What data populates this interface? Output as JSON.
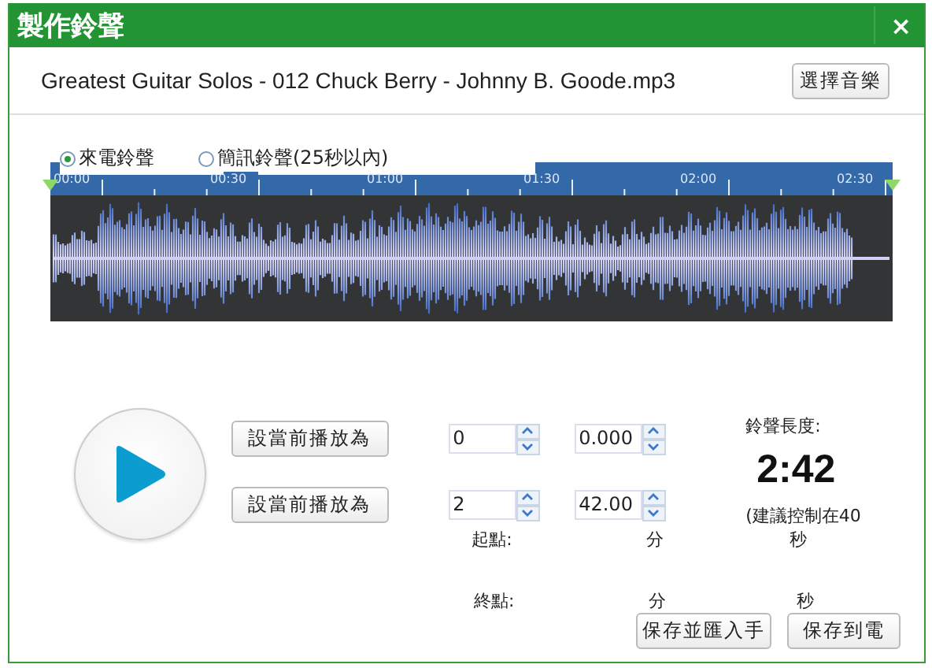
{
  "window": {
    "title": "製作鈴聲",
    "close": "×"
  },
  "file": {
    "name": "Greatest Guitar Solos - 012 Chuck Berry - Johnny B. Goode.mp3",
    "button": "選擇音樂"
  },
  "ringtone_types": [
    {
      "label": "來電鈴聲",
      "selected": true
    },
    {
      "label": "簡訊鈴聲(25秒以內)",
      "selected": false
    }
  ],
  "timeline": {
    "ticks": [
      "00:00",
      "00:30",
      "01:00",
      "01:30",
      "02:00",
      "02:30"
    ]
  },
  "start": {
    "button": "設當前播放為",
    "minutes": "0",
    "seconds": "0.000",
    "label": "起點:",
    "minutes_unit": "分",
    "seconds_unit": "秒"
  },
  "end": {
    "button": "設當前播放為",
    "minutes": "2",
    "seconds": "42.00",
    "label": "終點:",
    "minutes_unit": "分",
    "seconds_unit": "秒"
  },
  "length": {
    "label": "鈴聲長度:",
    "value": "2:42",
    "hint": "(建議控制在40"
  },
  "actions": [
    "保存並匯入手",
    "保存到電"
  ]
}
